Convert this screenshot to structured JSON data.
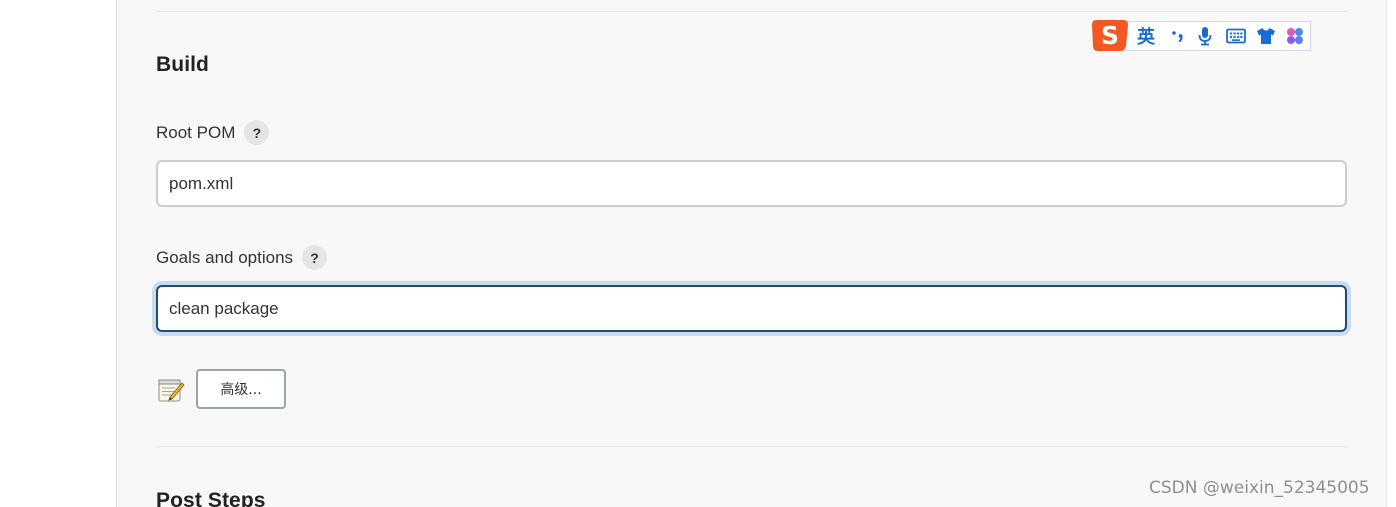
{
  "build": {
    "title": "Build",
    "root_pom": {
      "label": "Root POM",
      "help": "?",
      "value": "pom.xml"
    },
    "goals": {
      "label": "Goals and options",
      "help": "?",
      "value": "clean package"
    },
    "advanced_label": "高级..."
  },
  "post_steps": {
    "title": "Post Steps"
  },
  "ime_toolbar": {
    "logo": "S",
    "language": "英",
    "icons": [
      "punctuation-icon",
      "microphone-icon",
      "keyboard-icon",
      "skin-shirt-icon",
      "more-apps-icon"
    ]
  },
  "watermark": "CSDN @weixin_52345005",
  "colors": {
    "panel_bg": "#f8f8f8",
    "focus_border": "#1e4c74",
    "focus_ring": "#c8dced",
    "ime_blue": "#1a6bd3",
    "ime_orange": "#f05a22"
  }
}
